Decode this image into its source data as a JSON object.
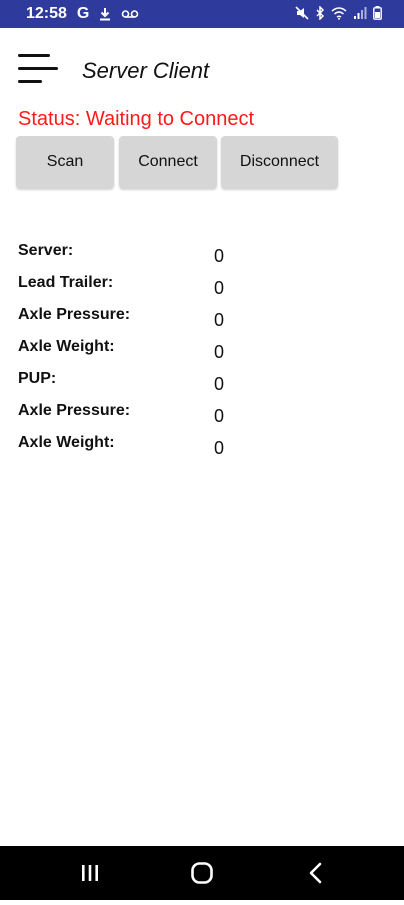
{
  "status_bar": {
    "time": "12:58",
    "g_label": "G"
  },
  "header": {
    "title": "Server Client"
  },
  "status": {
    "text": "Status: Waiting to Connect",
    "color": "#ff1a1a"
  },
  "buttons": {
    "scan": "Scan",
    "connect": "Connect",
    "disconnect": "Disconnect"
  },
  "readings": [
    {
      "label": "Server:",
      "value": "0"
    },
    {
      "label": "Lead Trailer:",
      "value": "0"
    },
    {
      "label": "Axle Pressure:",
      "value": "0"
    },
    {
      "label": "Axle Weight:",
      "value": "0"
    },
    {
      "label": "PUP:",
      "value": "0"
    },
    {
      "label": "Axle Pressure:",
      "value": "0"
    },
    {
      "label": "Axle Weight:",
      "value": "0"
    }
  ],
  "icons": {
    "menu": "hamburger-menu-icon",
    "nav_recents": "recents-icon",
    "nav_home": "home-icon",
    "nav_back": "back-icon"
  },
  "colors": {
    "status_bar_bg": "#2f3b9c",
    "button_bg": "#d6d6d6",
    "nav_bar_bg": "#000000"
  }
}
